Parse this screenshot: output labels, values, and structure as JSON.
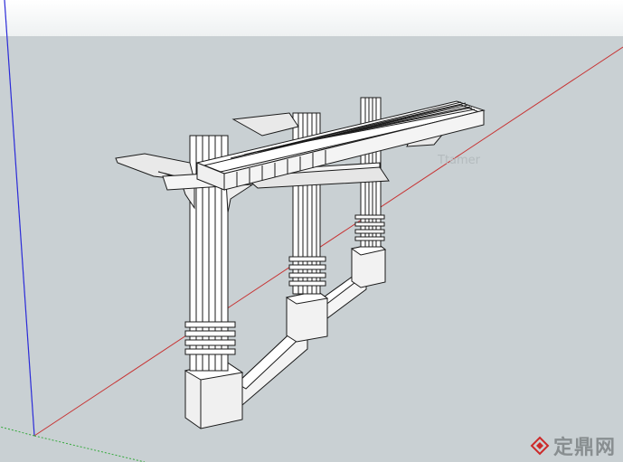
{
  "viewport": {
    "sky_color": "#ffffff",
    "ground_color": "#c9d0d3",
    "axes": {
      "blue": "#2b2bd8",
      "red": "#c73333",
      "green": "#33a83a"
    },
    "model_name": "pergola-model"
  },
  "watermark": {
    "logo_icon": "brand-logo-icon",
    "text": "定鼎网",
    "ghost_text": "Ttamer",
    "color": "#cc2a2a"
  }
}
